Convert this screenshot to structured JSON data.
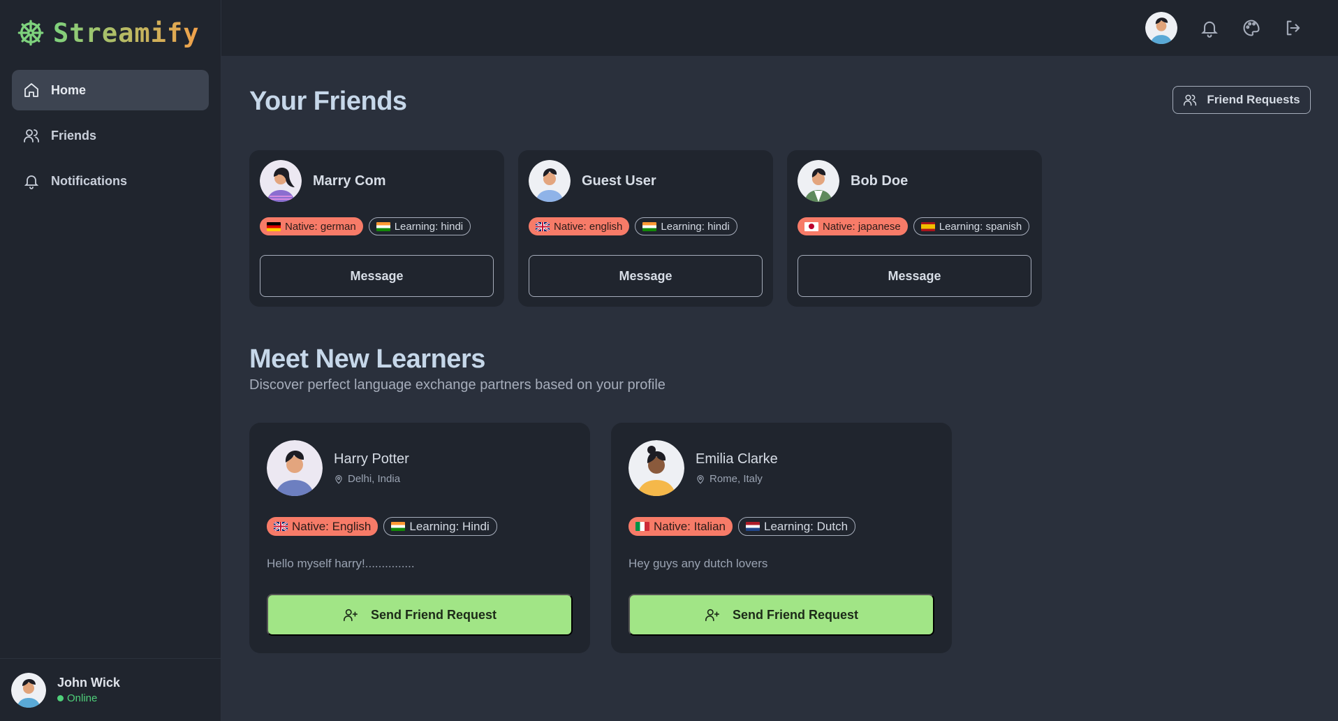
{
  "app": {
    "name": "Streamify",
    "logo_icon": "ship-wheel-icon"
  },
  "sidebar": {
    "items": [
      {
        "label": "Home",
        "icon": "home-icon",
        "active": true
      },
      {
        "label": "Friends",
        "icon": "users-icon",
        "active": false
      },
      {
        "label": "Notifications",
        "icon": "bell-icon",
        "active": false
      }
    ],
    "user": {
      "name": "John Wick",
      "status": "Online"
    }
  },
  "topbar": {
    "icons": [
      "avatar",
      "bell-icon",
      "palette-icon",
      "logout-icon"
    ]
  },
  "friends_section": {
    "title": "Your Friends",
    "requests_button": "Friend Requests",
    "friends": [
      {
        "name": "Marry Com",
        "native": "Native: german",
        "learning": "Learning: hindi",
        "native_flag": "de",
        "learning_flag": "in",
        "button": "Message"
      },
      {
        "name": "Guest User",
        "native": "Native: english",
        "learning": "Learning: hindi",
        "native_flag": "gb",
        "learning_flag": "in",
        "button": "Message"
      },
      {
        "name": "Bob Doe",
        "native": "Native: japanese",
        "learning": "Learning: spanish",
        "native_flag": "jp",
        "learning_flag": "es",
        "button": "Message"
      }
    ]
  },
  "learners_section": {
    "title": "Meet New Learners",
    "subtitle": "Discover perfect language exchange partners based on your profile",
    "learners": [
      {
        "name": "Harry Potter",
        "location": "Delhi, India",
        "native": "Native: English",
        "learning": "Learning: Hindi",
        "native_flag": "gb",
        "learning_flag": "in",
        "bio": "Hello myself harry!...............",
        "button": "Send Friend Request"
      },
      {
        "name": "Emilia Clarke",
        "location": "Rome, Italy",
        "native": "Native: Italian",
        "learning": "Learning: Dutch",
        "native_flag": "it",
        "learning_flag": "nl",
        "bio": "Hey guys any dutch lovers",
        "button": "Send Friend Request"
      }
    ]
  },
  "colors": {
    "native_badge": "#f77b68",
    "send_button": "#a1e586",
    "online": "#4fd07a",
    "title": "#c6d7e9"
  }
}
